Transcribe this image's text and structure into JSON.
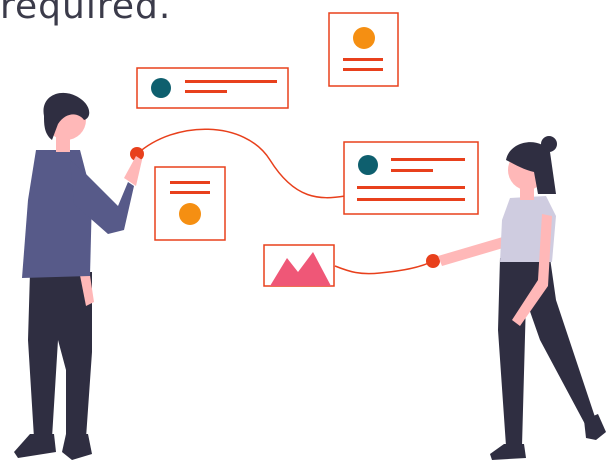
{
  "caption": {
    "text": "required."
  },
  "colors": {
    "accent": "#e8401c",
    "teal": "#0e5f6e",
    "orange": "#f58f12",
    "pink": "#ef5777",
    "shirt": "#575a89",
    "hair": "#2f2e41",
    "skin": "#ffb8b8",
    "top_woman": "#cfcce0"
  },
  "icons": {
    "card_profile_top_left": "profile-card-icon",
    "card_avatar_top_right": "avatar-card-icon",
    "card_avatar_middle_left": "avatar-card-icon",
    "card_profile_middle_right": "profile-card-icon",
    "card_image": "image-mountain-icon"
  }
}
